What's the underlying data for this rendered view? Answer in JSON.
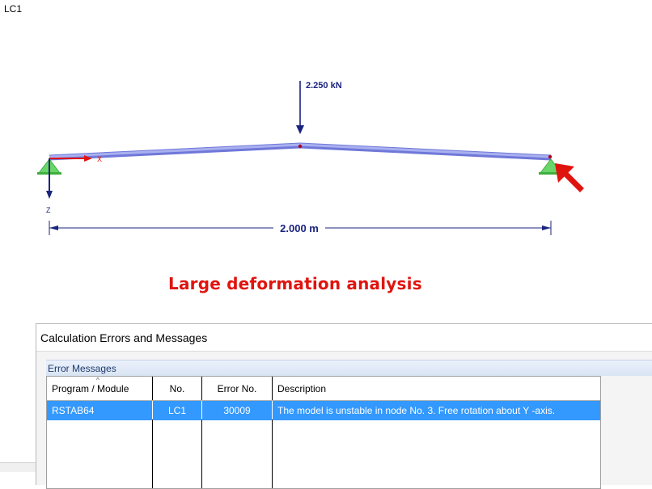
{
  "view": {
    "load_case": "LC1",
    "load_label": "2.250 kN",
    "dimension_label": "2.000 m",
    "axis_x": "X",
    "axis_z": "Z",
    "analysis_title": "Large deformation analysis"
  },
  "dialog": {
    "title": "Calculation Errors and Messages",
    "panel_title": "Error Messages",
    "columns": [
      "Program / Module",
      "No.",
      "Error No.",
      "Description"
    ],
    "rows": [
      {
        "program": "RSTAB64",
        "no": "LC1",
        "error_no": "30009",
        "description": "The model is unstable in node No. 3. Free rotation about Y -axis.",
        "selected": true
      }
    ]
  },
  "colors": {
    "member": "#8f97e6",
    "load_arrow": "#1a237e",
    "support": "#5fd35f",
    "highlight_arrow": "#e0140f",
    "selection": "#3399ff"
  }
}
